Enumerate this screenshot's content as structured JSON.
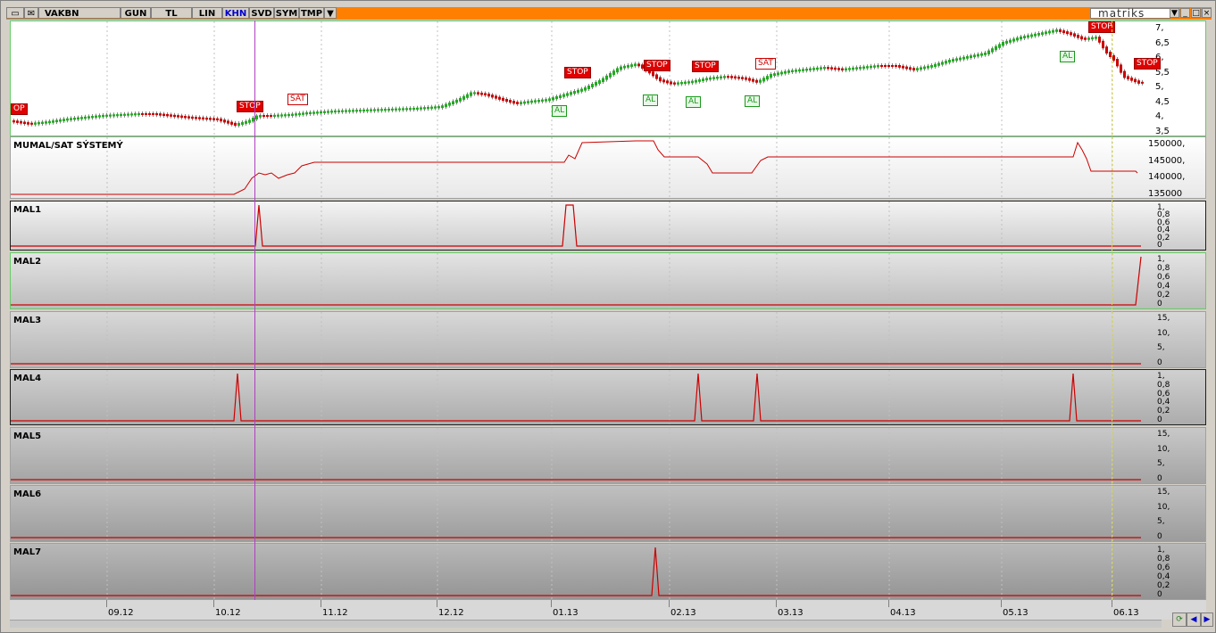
{
  "toolbar": {
    "symbol": "VAKBN",
    "buttons": [
      "GUN",
      "TL",
      "LIN",
      "KHN",
      "SVD",
      "SYM",
      "TMP"
    ],
    "logo": "matriks",
    "window_buttons": [
      "▼",
      "_",
      "□",
      "×"
    ]
  },
  "price_panel": {
    "yticks": [
      "7,",
      "6,5",
      "6,",
      "5,5",
      "5,",
      "4,5",
      "4,",
      "3,5"
    ],
    "signals": [
      {
        "text": "OP",
        "type": "red"
      },
      {
        "text": "STOP",
        "type": "red"
      },
      {
        "text": "SAT",
        "type": "redout"
      },
      {
        "text": "STOP",
        "type": "red"
      },
      {
        "text": "STOP",
        "type": "red"
      },
      {
        "text": "STOP",
        "type": "red"
      },
      {
        "text": "SAT",
        "type": "redout"
      },
      {
        "text": "STOP",
        "type": "red"
      },
      {
        "text": "STOP",
        "type": "red"
      },
      {
        "text": "AL",
        "type": "grn"
      },
      {
        "text": "AL",
        "type": "grn"
      },
      {
        "text": "AL",
        "type": "grn"
      },
      {
        "text": "AL",
        "type": "grn"
      },
      {
        "text": "AL",
        "type": "grn"
      }
    ]
  },
  "system_panel": {
    "title": "MUMAL/SAT SÝSTEMÝ",
    "yticks": [
      "150000,",
      "145000,",
      "140000,",
      "135000"
    ]
  },
  "indicator_panels": [
    {
      "title": "MAL1",
      "yticks": [
        "1,",
        "0,8",
        "0,6",
        "0,4",
        "0,2",
        "0"
      ]
    },
    {
      "title": "MAL2",
      "yticks": [
        "1,",
        "0,8",
        "0,6",
        "0,4",
        "0,2",
        "0"
      ]
    },
    {
      "title": "MAL3",
      "yticks": [
        "15,",
        "10,",
        "5,",
        "0"
      ]
    },
    {
      "title": "MAL4",
      "yticks": [
        "1,",
        "0,8",
        "0,6",
        "0,4",
        "0,2",
        "0"
      ]
    },
    {
      "title": "MAL5",
      "yticks": [
        "15,",
        "10,",
        "5,",
        "0"
      ]
    },
    {
      "title": "MAL6",
      "yticks": [
        "15,",
        "10,",
        "5,",
        "0"
      ]
    },
    {
      "title": "MAL7",
      "yticks": [
        "1,",
        "0,8",
        "0,6",
        "0,4",
        "0,2",
        "0"
      ]
    }
  ],
  "time_axis": [
    "09.12",
    "10.12",
    "11.12",
    "12.12",
    "01.13",
    "02.13",
    "03.13",
    "04.13",
    "05.13",
    "06.13"
  ],
  "colors": {
    "toolbar": "#ff8000",
    "line": "#cc0000",
    "up": "#22aa22",
    "down": "#cc0000",
    "cursor": "#b040c0"
  }
}
